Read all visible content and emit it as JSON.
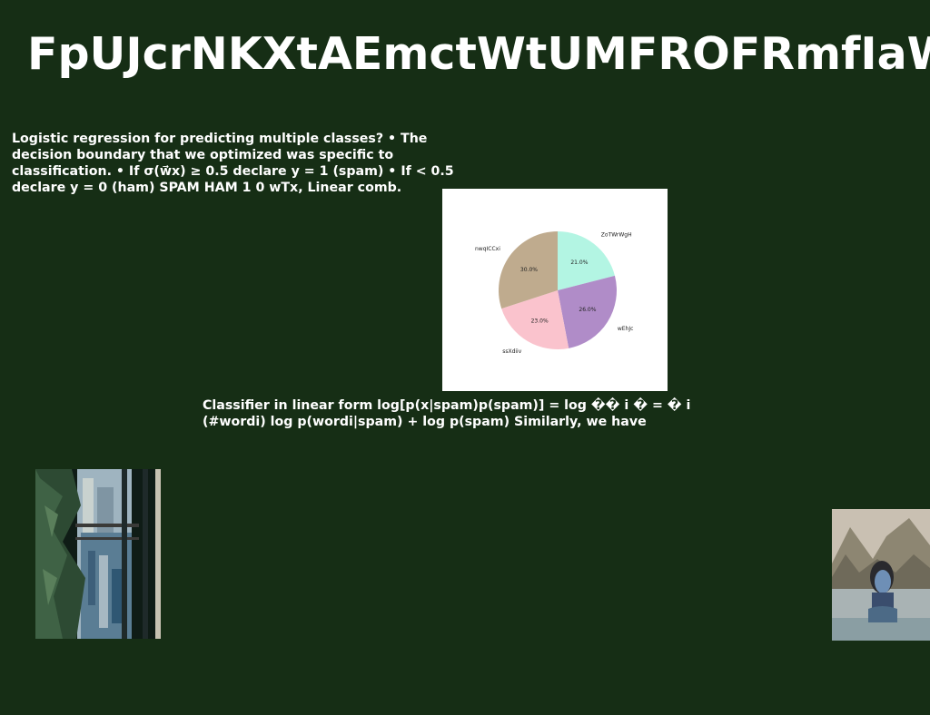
{
  "slide": {
    "title": "FpUJcrNKXtAEmctWtUMFROFRmfIaW",
    "paragraph_1": "Logistic regression for predicting multiple classes? • The decision boundary that we optimized was specific to classification. • If σ(w⃗x) ≥ 0.5 declare y = 1 (spam) • If < 0.5 declare y = 0 (ham) SPAM HAM 1 0 wTx, Linear comb.",
    "paragraph_2": "Classifier in linear form log[p(x|spam)p(spam)] = log �� i � = � i (#wordi) log p(wordi|spam) + log p(spam) Similarly, we have"
  },
  "images": {
    "window_photo": "city-view-through-window",
    "lake_photo": "woman-in-water-with-mountains"
  },
  "chart_data": {
    "type": "pie",
    "slices": [
      {
        "label": "ZoTWrWgH",
        "value": 21.0,
        "pct_label": "21.0%",
        "color": "#b3f5e3"
      },
      {
        "label": "wEhJc",
        "value": 26.0,
        "pct_label": "26.0%",
        "color": "#b08cc8"
      },
      {
        "label": "ssXdiiv",
        "value": 23.0,
        "pct_label": "23.0%",
        "color": "#fac3cd"
      },
      {
        "label": "nwqICCxi",
        "value": 30.0,
        "pct_label": "30.0%",
        "color": "#bfab8e"
      }
    ],
    "start_angle_deg": 90,
    "direction": "clockwise"
  }
}
